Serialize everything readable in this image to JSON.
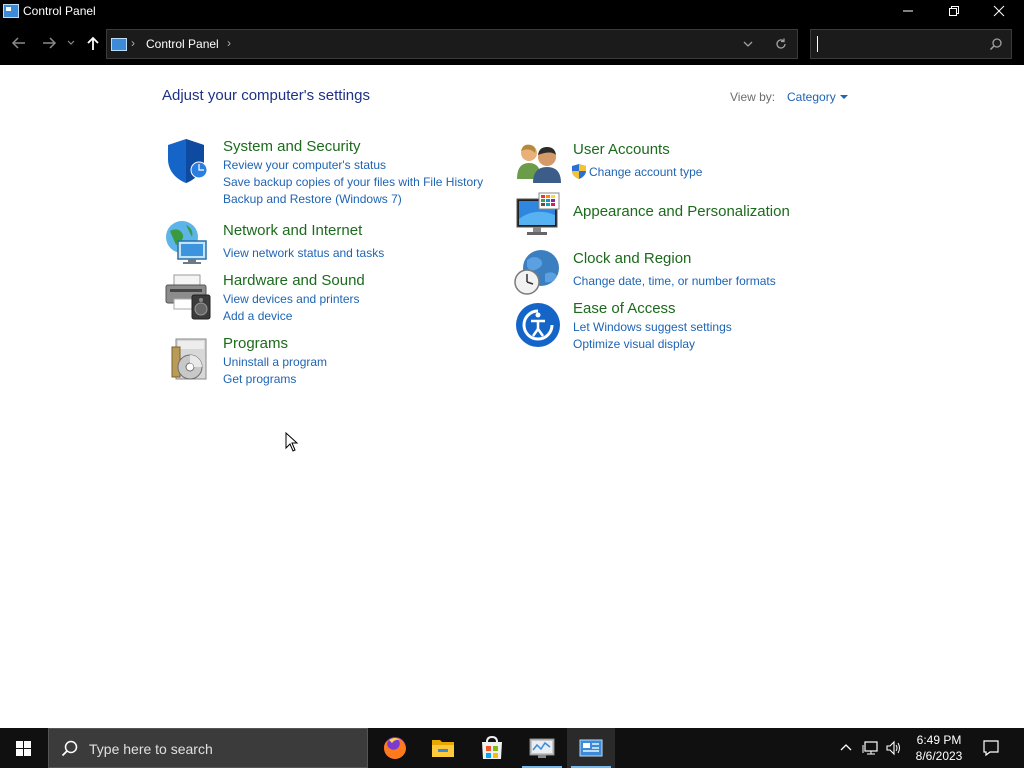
{
  "window": {
    "title": "Control Panel",
    "controls": {
      "minimize": "minimize",
      "restore": "restore",
      "close": "close"
    }
  },
  "navbar": {
    "breadcrumb": "Control Panel",
    "search": {
      "value": "",
      "placeholder": ""
    }
  },
  "main": {
    "heading": "Adjust your computer's settings",
    "view_by_label": "View by:",
    "view_by_value": "Category",
    "categories_left": [
      {
        "title": "System and Security",
        "icon": "shield-icon",
        "links": [
          "Review your computer's status",
          "Save backup copies of your files with File History",
          "Backup and Restore (Windows 7)"
        ]
      },
      {
        "title": "Network and Internet",
        "icon": "network-globe-icon",
        "links": [
          "View network status and tasks"
        ]
      },
      {
        "title": "Hardware and Sound",
        "icon": "printer-speaker-icon",
        "links": [
          "View devices and printers",
          "Add a device"
        ]
      },
      {
        "title": "Programs",
        "icon": "programs-disc-icon",
        "links": [
          "Uninstall a program",
          "Get programs"
        ]
      }
    ],
    "categories_right": [
      {
        "title": "User Accounts",
        "icon": "users-icon",
        "links": [
          "Change account type"
        ]
      },
      {
        "title": "Appearance and Personalization",
        "icon": "monitor-palette-icon",
        "links": []
      },
      {
        "title": "Clock and Region",
        "icon": "clock-globe-icon",
        "links": [
          "Change date, time, or number formats"
        ]
      },
      {
        "title": "Ease of Access",
        "icon": "ease-of-access-icon",
        "links": [
          "Let Windows suggest settings",
          "Optimize visual display"
        ]
      }
    ]
  },
  "taskbar": {
    "search_placeholder": "Type here to search",
    "time": "6:49 PM",
    "date": "8/6/2023",
    "apps": [
      "firefox-icon",
      "file-explorer-icon",
      "store-icon",
      "control-panel-monitor-icon",
      "control-panel-icon"
    ]
  },
  "colors": {
    "title_bar": "#000000",
    "category_title": "#1c6b1c",
    "link": "#1e64b4",
    "heading": "#1e3287",
    "taskbar": "#101010"
  }
}
